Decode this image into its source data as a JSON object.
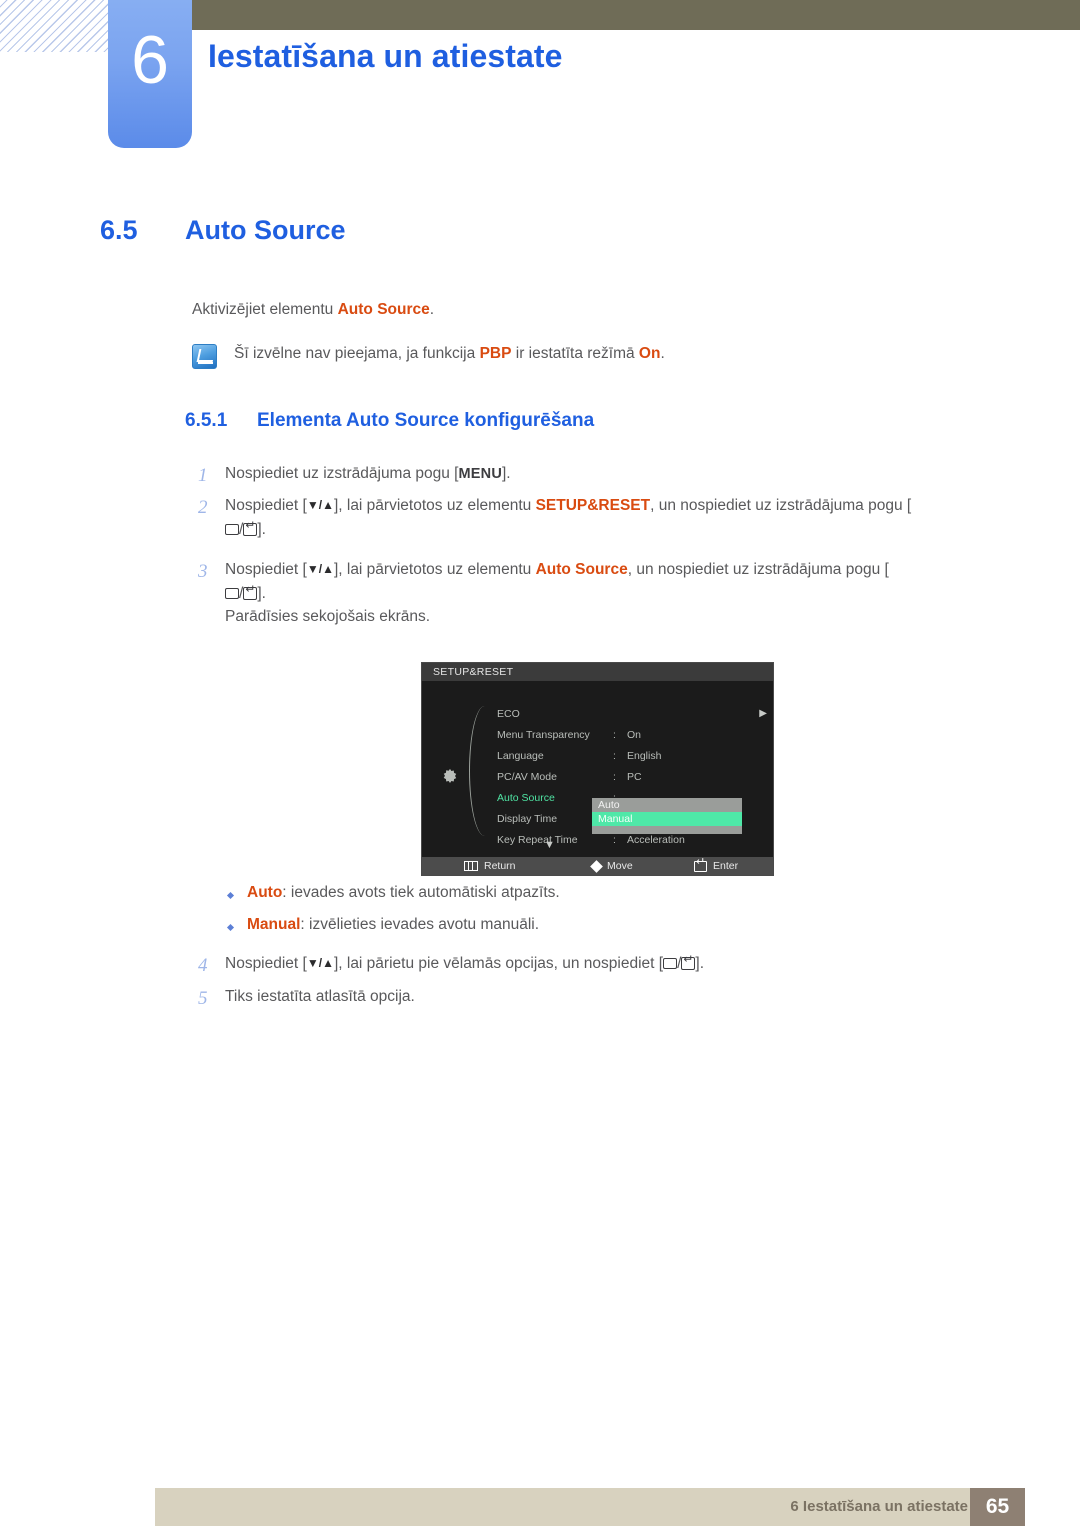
{
  "header": {
    "chapter_number": "6",
    "chapter_title": "Iestatīšana un atiestate",
    "bar_color": "#6f6c57",
    "accent_blue": "#1f5fe0"
  },
  "section": {
    "number": "6.5",
    "title": "Auto Source",
    "intro_prefix": "Aktivizējiet elementu ",
    "intro_accent": "Auto Source",
    "intro_suffix": "."
  },
  "note": {
    "icon": "note-pencil-icon",
    "text_part1": "Šī izvēlne nav pieejama, ja funkcija ",
    "accent1": "PBP",
    "text_part2": " ir iestatīta režīmā ",
    "accent2": "On",
    "text_part3": "."
  },
  "subsection": {
    "number": "6.5.1",
    "title": "Elementa Auto Source konfigurēšana"
  },
  "steps": [
    {
      "index": "1",
      "text_a": "Nospiediet uz izstrādājuma pogu [",
      "key": "MENU",
      "text_b": "]."
    },
    {
      "index": "2",
      "text_a": "Nospiediet [",
      "arrows": "▼/▲",
      "text_b": "], lai pārvietotos uz elementu ",
      "accent": "SETUP&RESET",
      "text_c": ", un nospiediet uz izstrādājuma pogu [",
      "text_d": "/",
      "text_e": "]."
    },
    {
      "index": "3",
      "text_a": "Nospiediet [",
      "arrows": "▼/▲",
      "text_b": "], lai pārvietotos uz elementu ",
      "accent": "Auto Source",
      "text_c": ", un nospiediet uz izstrādājuma pogu [",
      "text_d": "/",
      "text_e": "].",
      "extra_line": "Parādīsies sekojošais ekrāns."
    },
    {
      "index": "4",
      "text_a": "Nospiediet [",
      "arrows": "▼/▲",
      "text_b": "], lai pārietu pie vēlamās opcijas, un nospiediet [",
      "text_c": "/",
      "text_d": "]."
    },
    {
      "index": "5",
      "text_a": "Tiks iestatīta atlasītā opcija."
    }
  ],
  "osd": {
    "title": "SETUP&RESET",
    "gear_icon": "gear-icon",
    "rows": [
      {
        "label": "ECO",
        "colon": "",
        "value": "",
        "chevron": "▶",
        "selected": false
      },
      {
        "label": "Menu Transparency",
        "colon": ":",
        "value": "On",
        "chevron": "",
        "selected": false
      },
      {
        "label": "Language",
        "colon": ":",
        "value": "English",
        "chevron": "",
        "selected": false
      },
      {
        "label": "PC/AV Mode",
        "colon": ":",
        "value": "PC",
        "chevron": "",
        "selected": false
      },
      {
        "label": "Auto Source",
        "colon": ":",
        "value": "",
        "chevron": "",
        "selected": true
      },
      {
        "label": "Display Time",
        "colon": ":",
        "value": "",
        "chevron": "",
        "selected": false
      },
      {
        "label": "Key Repeat Time",
        "colon": ":",
        "value": "Acceleration",
        "chevron": "",
        "selected": false
      }
    ],
    "scroll_down": "▼",
    "popup": {
      "options": [
        {
          "label": "Auto",
          "highlighted": false
        },
        {
          "label": "Manual",
          "highlighted": true
        }
      ],
      "bg_color": "#9a9d9a",
      "highlight_color": "#4fe8a8"
    },
    "footer": {
      "return_label": "Return",
      "return_icon": "menu-bars-icon",
      "move_label": "Move",
      "move_icon": "diamond-icon",
      "enter_label": "Enter",
      "enter_icon": "enter-key-icon"
    }
  },
  "bullets": [
    {
      "accent": "Auto",
      "text": ": ievades avots tiek automātiski atpazīts."
    },
    {
      "accent": "Manual",
      "text": ": izvēlieties ievades avotu manuāli."
    }
  ],
  "footer": {
    "text": "6 Iestatīšana un atiestate",
    "page_number": "65",
    "band_color": "#d8d2bf",
    "page_box_color": "#8e8073"
  }
}
